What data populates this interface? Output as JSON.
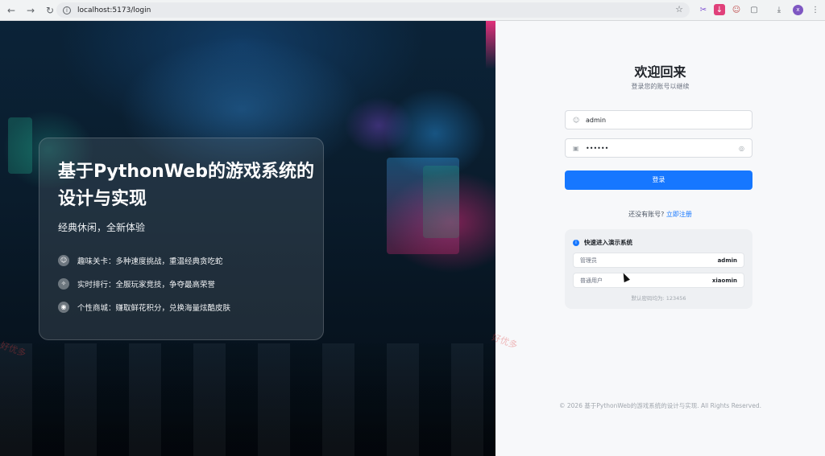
{
  "browser": {
    "url": "localhost:5173/login",
    "profile_initial": "x"
  },
  "hero": {
    "title": "基于PythonWeb的游戏系统的设计与实现",
    "subtitle": "经典休闲，全新体验",
    "features": [
      {
        "icon": "game-icon",
        "text": "趣味关卡：多种速度挑战，重温经典贪吃蛇"
      },
      {
        "icon": "trophy-icon",
        "text": "实时排行：全服玩家竞技，争夺最高荣誉"
      },
      {
        "icon": "shop-icon",
        "text": "个性商城：赚取鲜花积分，兑换海量炫酷皮肤"
      }
    ]
  },
  "login": {
    "heading": "欢迎回来",
    "subheading": "登录您的账号以继续",
    "username_value": "admin",
    "password_value": "••••••",
    "submit_label": "登录",
    "register_prompt": "还没有账号?",
    "register_link": "立即注册"
  },
  "demo": {
    "title": "快速进入演示系统",
    "accounts": [
      {
        "role": "管理员",
        "username": "admin"
      },
      {
        "role": "普通用户",
        "username": "xiaomin"
      }
    ],
    "note": "默认密码均为: 123456"
  },
  "footer": {
    "text": "© 2026 基于PythonWeb的游戏系统的设计与实现. All Rights Reserved."
  },
  "watermark": "好优多",
  "colors": {
    "accent": "#1677ff",
    "panel_bg": "#f7f8fa"
  }
}
